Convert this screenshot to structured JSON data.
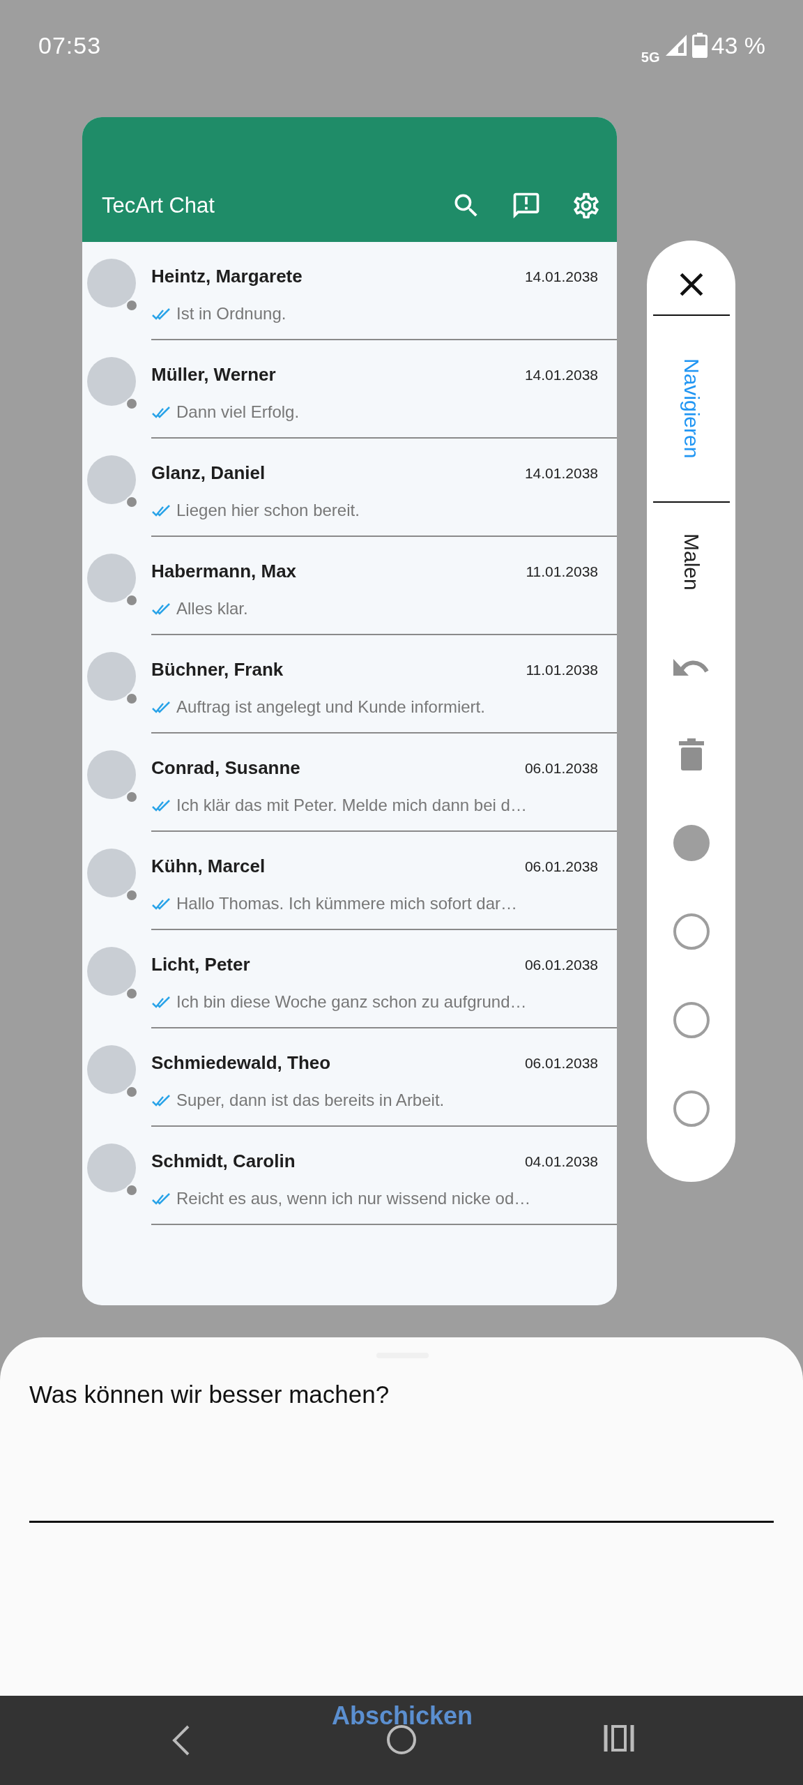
{
  "status_bar": {
    "time": "07:53",
    "network": "5G",
    "battery": "43 %"
  },
  "app": {
    "title": "TecArt Chat"
  },
  "chats": [
    {
      "name": "Heintz, Margarete",
      "date": "14.01.2038",
      "message": "Ist in Ordnung."
    },
    {
      "name": "Müller, Werner",
      "date": "14.01.2038",
      "message": "Dann viel Erfolg."
    },
    {
      "name": "Glanz, Daniel",
      "date": "14.01.2038",
      "message": "Liegen hier schon bereit."
    },
    {
      "name": "Habermann, Max",
      "date": "11.01.2038",
      "message": "Alles klar."
    },
    {
      "name": "Büchner, Frank",
      "date": "11.01.2038",
      "message": "Auftrag ist angelegt und Kunde informiert."
    },
    {
      "name": "Conrad, Susanne",
      "date": "06.01.2038",
      "message": "Ich klär das mit Peter. Melde mich dann bei d…"
    },
    {
      "name": "Kühn, Marcel",
      "date": "06.01.2038",
      "message": "Hallo Thomas. Ich kümmere mich sofort dar…"
    },
    {
      "name": "Licht, Peter",
      "date": "06.01.2038",
      "message": "Ich bin diese Woche ganz schon zu aufgrund…"
    },
    {
      "name": "Schmiedewald, Theo",
      "date": "06.01.2038",
      "message": "Super, dann ist das bereits in Arbeit."
    },
    {
      "name": "Schmidt, Carolin",
      "date": "04.01.2038",
      "message": "Reicht es aus, wenn ich nur wissend nicke od…"
    }
  ],
  "side_panel": {
    "modes": [
      {
        "label": "Navigieren",
        "selected": true
      },
      {
        "label": "Malen",
        "selected": false
      }
    ],
    "brush_options": [
      {
        "selected": true
      },
      {
        "selected": false
      },
      {
        "selected": false
      },
      {
        "selected": false
      }
    ]
  },
  "feedback_sheet": {
    "question": "Was können wir besser machen?",
    "submit": "Abschicken"
  }
}
